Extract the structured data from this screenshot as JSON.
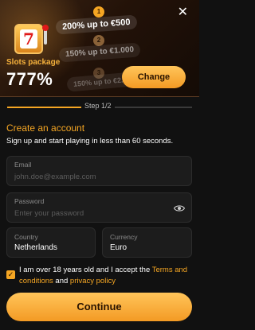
{
  "banner": {
    "package_label": "Slots package",
    "package_value": "777%",
    "offers": [
      {
        "step": "1",
        "label": "200% up to €500"
      },
      {
        "step": "2",
        "label": "150% up to €1.000"
      },
      {
        "step": "3",
        "label": "150% up to €2.0"
      }
    ],
    "change_label": "Change",
    "close_glyph": "✕"
  },
  "progress": {
    "step_label": "Step 1/2",
    "fraction": 0.5,
    "accent": "#f5a623"
  },
  "form": {
    "title": "Create an account",
    "subtitle": "Sign up and start playing in less than 60 seconds.",
    "email": {
      "label": "Email",
      "placeholder": "john.doe@example.com",
      "value": ""
    },
    "password": {
      "label": "Password",
      "placeholder": "Enter your password",
      "value": ""
    },
    "country": {
      "label": "Country",
      "value": "Netherlands"
    },
    "currency": {
      "label": "Currency",
      "value": "Euro"
    },
    "terms": {
      "checked": true,
      "text_before": "I am over 18 years old and I accept the ",
      "terms_link": "Terms and conditions",
      "text_middle": " and ",
      "privacy_link": "privacy policy"
    },
    "continue_label": "Continue"
  },
  "icons": {
    "close": "close-icon",
    "eye": "eye-icon",
    "checkbox": "checkmark-icon",
    "slot": "slot-machine-icon"
  }
}
